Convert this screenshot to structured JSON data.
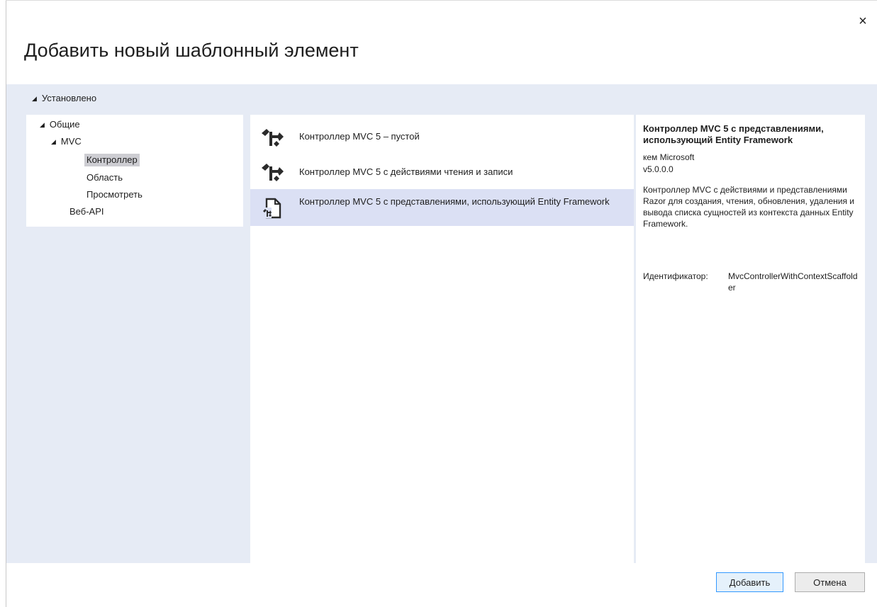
{
  "dialog": {
    "title": "Добавить новый шаблонный элемент",
    "close_glyph": "×"
  },
  "installed": {
    "label": "Установлено",
    "toggle_glyph": "◢"
  },
  "tree": {
    "items": [
      {
        "label": "Общие",
        "toggle_glyph": "◢",
        "expanded": true
      },
      {
        "label": "MVC",
        "toggle_glyph": "◢",
        "expanded": true
      },
      {
        "label": "Контроллер",
        "selected": true
      },
      {
        "label": "Область"
      },
      {
        "label": "Просмотреть"
      },
      {
        "label": "Веб-API"
      }
    ]
  },
  "templates": {
    "items": [
      {
        "label": "Контроллер MVC 5 – пустой",
        "icon": "controller-icon"
      },
      {
        "label": "Контроллер MVC 5 с действиями чтения и записи",
        "icon": "controller-icon"
      },
      {
        "label": "Контроллер MVC 5 с представлениями, использующий Entity Framework",
        "icon": "document-controller-icon",
        "selected": true
      }
    ]
  },
  "details": {
    "title": "Контроллер MVC 5 с представлениями, использующий Entity Framework",
    "author": "кем Microsoft",
    "version": "v5.0.0.0",
    "description": "Контроллер MVC с действиями и представлениями Razor для создания, чтения, обновления, удаления и вывода списка сущностей из контекста данных Entity Framework.",
    "id_label": "Идентификатор:",
    "id_value": "MvcControllerWithContextScaffolder"
  },
  "buttons": {
    "add": "Добавить",
    "cancel": "Отмена"
  },
  "colors": {
    "content_background": "#e6ebf5",
    "selected_item": "#dbe0f4",
    "selected_tree_item": "#cdcdd2",
    "primary_button_border": "#3399ff"
  }
}
